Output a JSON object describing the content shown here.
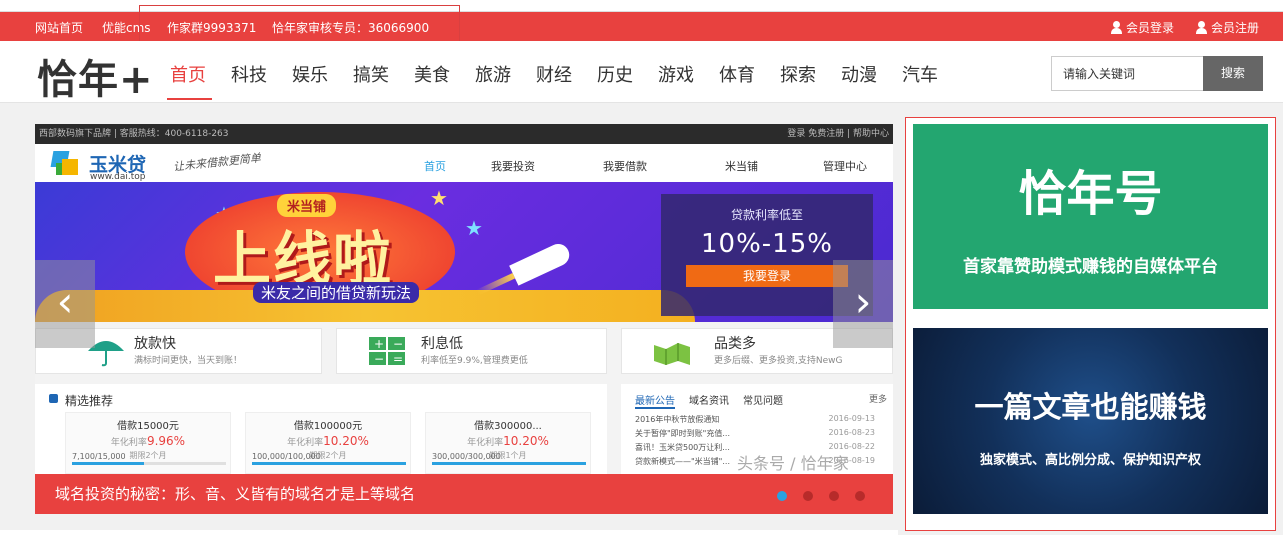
{
  "topbar": {
    "links": [
      "网站首页",
      "优能cms",
      "作家群9993371",
      "恰年家审核专员：36066900"
    ],
    "login": "会员登录",
    "register": "会员注册"
  },
  "header": {
    "logo": "恰年+",
    "nav": [
      "首页",
      "科技",
      "娱乐",
      "搞笑",
      "美食",
      "旅游",
      "财经",
      "历史",
      "游戏",
      "体育",
      "探索",
      "动漫",
      "汽车"
    ],
    "active_index": 0,
    "search": {
      "placeholder": "请输入关键词",
      "button": "搜索"
    }
  },
  "slider": {
    "site_topbar_left": "西部数码旗下品牌 | 客服热线：400-6118-263",
    "site_topbar_right": "登录 免费注册 | 帮助中心",
    "site_brand": "玉米贷",
    "site_url": "www.dai.top",
    "site_slogan": "让未来借款更简单",
    "site_nav": [
      "首页",
      "我要投资",
      "我要借款",
      "米当铺",
      "管理中心"
    ],
    "hero": {
      "tag": "米当铺",
      "headline": "上线啦",
      "subline": "米友之间的借贷新玩法",
      "rate_label": "贷款利率低至",
      "rate_value": "10%-15%",
      "rate_button": "我要登录"
    },
    "features": [
      {
        "title": "放款快",
        "desc": "满标时间更快，当天到账！"
      },
      {
        "title": "利息低",
        "desc": "利率低至9.9%,管理费更低"
      },
      {
        "title": "品类多",
        "desc": "更多后缀、更多投资,支持NewG"
      }
    ],
    "picks_title": "精选推荐",
    "loans": [
      {
        "name": "借款15000元",
        "rate_label": "年化利率",
        "rate": "9.96%",
        "term": "期限2个月",
        "amount": "7,100/15,000",
        "progress": 0.47
      },
      {
        "name": "借款100000元",
        "rate_label": "年化利率",
        "rate": "10.20%",
        "term": "期限2个月",
        "amount": "100,000/100,000",
        "progress": 1.0
      },
      {
        "name": "借款300000...",
        "rate_label": "年化利率",
        "rate": "10.20%",
        "term": "期限1个月",
        "amount": "300,000/300,000",
        "progress": 1.0
      }
    ],
    "news_tabs": [
      "最新公告",
      "域名资讯",
      "常见问题"
    ],
    "news_more": "更多",
    "news": [
      {
        "title": "2016年中秋节放假通知",
        "date": "2016-09-13"
      },
      {
        "title": "关于暂停\"即时到账\"充值...",
        "date": "2016-08-23"
      },
      {
        "title": "喜讯！玉米贷500万让利...",
        "date": "2016-08-22"
      },
      {
        "title": "贷款新模式——\"米当铺\"...",
        "date": "2016-08-19"
      }
    ],
    "watermark": "头条号 / 恰年家",
    "caption": "域名投资的秘密：形、音、义皆有的域名才是上等域名",
    "dots": 4,
    "active_dot": 0
  },
  "sidebar": {
    "ad1": {
      "title": "恰年号",
      "subtitle": "首家靠赞助模式赚钱的自媒体平台"
    },
    "ad2": {
      "title": "一篇文章也能赚钱",
      "subtitle": "独家模式、高比例分成、保护知识产权"
    }
  }
}
